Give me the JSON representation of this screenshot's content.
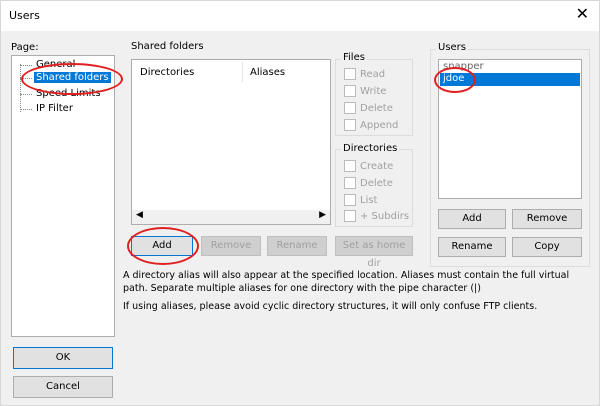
{
  "window": {
    "title": "Users"
  },
  "page": {
    "label": "Page:",
    "tree": [
      "General",
      "Shared folders",
      "Speed Limits",
      "IP Filter"
    ]
  },
  "shared": {
    "label": "Shared folders",
    "columns": [
      "Directories",
      "Aliases"
    ],
    "buttons": {
      "add": "Add",
      "remove": "Remove",
      "rename": "Rename",
      "set_home": "Set as home dir"
    }
  },
  "files": {
    "label": "Files",
    "options": [
      "Read",
      "Write",
      "Delete",
      "Append"
    ]
  },
  "directories": {
    "label": "Directories",
    "options": [
      "Create",
      "Delete",
      "List",
      "+ Subdirs"
    ]
  },
  "users": {
    "label": "Users",
    "list": [
      "snapper",
      "jdoe"
    ],
    "buttons": {
      "add": "Add",
      "remove": "Remove",
      "rename": "Rename",
      "copy": "Copy"
    }
  },
  "hints": {
    "line1": "A directory alias will also appear at the specified location. Aliases must contain the full virtual",
    "line2": "path. Separate multiple aliases for one directory with the pipe character (|)",
    "line3": "If using aliases, please avoid cyclic directory structures, it will only confuse FTP clients."
  },
  "dialog": {
    "ok": "OK",
    "cancel": "Cancel"
  }
}
